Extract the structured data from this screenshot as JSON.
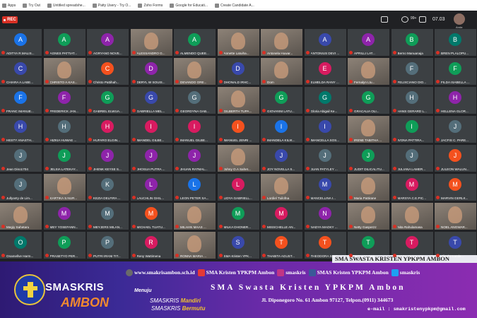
{
  "bookmarks": [
    "Apps",
    "Try Out",
    "Untitled spreadshe...",
    "Patty Usery - Try O...",
    "Zoho Forms",
    "Google for Educati...",
    "Create Candidate A..."
  ],
  "rec_label": "REC",
  "time": "07.03",
  "participant_count": "99+",
  "you_label": "Anda",
  "tiles": [
    {
      "n": "ADITYA R.MALIS...",
      "a": "A",
      "c": "#1a73e8"
    },
    {
      "n": "AGNES PATTIAT...",
      "a": "A",
      "c": "#0f9d58"
    },
    {
      "n": "AGRYANO NOVE...",
      "a": "A",
      "c": "#8e24aa"
    },
    {
      "n": "ALESSANDRO G...",
      "p": 1
    },
    {
      "n": "ALMENDO QUEE...",
      "a": "A",
      "c": "#0f9d58"
    },
    {
      "n": "Annette Latuiha...",
      "p": 1
    },
    {
      "n": "Antonela Huwar...",
      "p": 1
    },
    {
      "n": "ANTONIUS DEVI ...",
      "a": "A",
      "c": "#3949ab"
    },
    {
      "n": "APRILLI LAT...",
      "a": "A",
      "c": "#8e24aa"
    },
    {
      "n": "Berno Manuanaja",
      "a": "B",
      "c": "#0f9d58"
    },
    {
      "n": "BREN PLALOPU...",
      "a": "B",
      "c": "#00796b"
    },
    {
      "n": "CHIARA A.LABE...",
      "a": "C",
      "c": "#3949ab"
    },
    {
      "n": "CHRISTO A.KAS...",
      "p": 1
    },
    {
      "n": "Christo Pattihah...",
      "a": "C",
      "c": "#f4511e"
    },
    {
      "n": "DERYL W SOUIS...",
      "a": "D",
      "c": "#8e24aa"
    },
    {
      "n": "DEVANDO ORE...",
      "p": 1
    },
    {
      "n": "DHONALD IRHC...",
      "a": "D",
      "c": "#3949ab"
    },
    {
      "n": "Dom",
      "p": 1
    },
    {
      "n": "ELMELDA RANY ...",
      "a": "E",
      "c": "#d81b60"
    },
    {
      "n": "Fernalyn Ltu...",
      "p": 1
    },
    {
      "n": "FELIXCIANO DIO...",
      "a": "F",
      "c": "#546e7a"
    },
    {
      "n": "FILDA ISABELLA ...",
      "a": "F",
      "c": "#0f9d58"
    },
    {
      "n": "FRANC IMANUE...",
      "a": "F",
      "c": "#1a73e8"
    },
    {
      "n": "FREDERICK JAN...",
      "a": "F",
      "c": "#8e24aa"
    },
    {
      "n": "GABRIEL ELWUA...",
      "a": "G",
      "c": "#0f9d58"
    },
    {
      "n": "GABRIELLA MEL...",
      "a": "G",
      "c": "#3949ab"
    },
    {
      "n": "GEORDYNA GAB...",
      "a": "G",
      "c": "#546e7a"
    },
    {
      "n": "GILBERTH TUPA...",
      "p": 1
    },
    {
      "n": "GIOVANNI LATU...",
      "a": "G",
      "c": "#0f9d58"
    },
    {
      "n": "Gloria Abigail Ke...",
      "a": "G",
      "c": "#00796b"
    },
    {
      "n": "GRACALIA OLI...",
      "a": "G",
      "c": "#0f9d58"
    },
    {
      "n": "HANS GERARD L...",
      "a": "H",
      "c": "#546e7a"
    },
    {
      "n": "HELLENA GLOR...",
      "a": "H",
      "c": "#8e24aa"
    },
    {
      "n": "HESTY ANASTH...",
      "a": "H",
      "c": "#3949ab"
    },
    {
      "n": "HIZKIA HUWAE ...",
      "a": "H",
      "c": "#546e7a"
    },
    {
      "n": "HUFARO ELGIN...",
      "a": "H",
      "c": "#d81b60"
    },
    {
      "n": "IMANDEL GILBE...",
      "a": "I",
      "c": "#d81b60"
    },
    {
      "n": "IMANUEL GILBE...",
      "a": "I",
      "c": "#d81b60"
    },
    {
      "n": "IMANUEL JENRI ...",
      "a": "I",
      "c": "#f4511e"
    },
    {
      "n": "IMANDELA KILIK...",
      "a": "I",
      "c": "#1a73e8"
    },
    {
      "n": "IMANCELLA SOS...",
      "a": "I",
      "c": "#3949ab"
    },
    {
      "n": "IRENE TABITHA ...",
      "p": 1
    },
    {
      "n": "IVONA PATTIRA...",
      "a": "I",
      "c": "#0f9d58"
    },
    {
      "n": "JACFIS C. PARE...",
      "a": "J",
      "c": "#546e7a"
    },
    {
      "n": "Jean Dino1704",
      "a": "J",
      "c": "#546e7a"
    },
    {
      "n": "JELSIA LATEKAY...",
      "a": "J",
      "c": "#0f9d58"
    },
    {
      "n": "JHENK KEYSE S...",
      "a": "J",
      "c": "#8e24aa"
    },
    {
      "n": "JHOSUA PUTRA ...",
      "a": "J",
      "c": "#8e24aa"
    },
    {
      "n": "JHUAN RATMAL...",
      "a": "J",
      "c": "#8e24aa"
    },
    {
      "n": "Johny O.A Sahet...",
      "p": 1
    },
    {
      "n": "JOY NOVELLA S...",
      "a": "J",
      "c": "#3949ab"
    },
    {
      "n": "JUAN PATYLEY ...",
      "a": "J",
      "c": "#546e7a"
    },
    {
      "n": "JUDIT DILICALITU...",
      "a": "J",
      "c": "#0f9d58"
    },
    {
      "n": "JULIANA LAMER...",
      "a": "J",
      "c": "#546e7a"
    },
    {
      "n": "JULEON WALUN...",
      "a": "J",
      "c": "#f4511e"
    },
    {
      "n": "Jullyanty de Lim...",
      "a": "J",
      "c": "#546e7a"
    },
    {
      "n": "KARTIKA S.NUR...",
      "p": 1
    },
    {
      "n": "KEZIA DELFIRA ...",
      "a": "K",
      "c": "#546e7a"
    },
    {
      "n": "LAUCHLIN GHIL...",
      "a": "L",
      "c": "#8e24aa"
    },
    {
      "n": "LEON PETER SA...",
      "a": "L",
      "c": "#1a73e8"
    },
    {
      "n": "LIDYA GABRIELL...",
      "a": "L",
      "c": "#d81b60"
    },
    {
      "n": "Lordiel Tuilofna",
      "p": 1
    },
    {
      "n": "MANCELLINA I...",
      "a": "M",
      "c": "#3949ab"
    },
    {
      "n": "Maria Pattirane",
      "p": 1
    },
    {
      "n": "MARSYA C.E.PIC...",
      "a": "M",
      "c": "#d81b60"
    },
    {
      "n": "MARVIN GERLK...",
      "a": "M",
      "c": "#f4511e"
    },
    {
      "n": "Megiy Sahetaru",
      "p": 1
    },
    {
      "n": "MEY YOSEFANN...",
      "a": "M",
      "c": "#8e24aa"
    },
    {
      "n": "MEYJERS MILAN...",
      "a": "M",
      "c": "#546e7a"
    },
    {
      "n": "MICHAEL TUATU...",
      "a": "M",
      "c": "#f4511e"
    },
    {
      "n": "MILHAN MAAS ...",
      "p": 1
    },
    {
      "n": "MILKA DHONER...",
      "a": "M",
      "c": "#0f9d58"
    },
    {
      "n": "MISSCHELLE AN...",
      "a": "M",
      "c": "#d81b60"
    },
    {
      "n": "NADYA MAOKY ...",
      "a": "N",
      "c": "#8e24aa"
    },
    {
      "n": "Netty Gasperzz",
      "p": 1
    },
    {
      "n": "Nita Rahulamasa",
      "p": 1
    },
    {
      "n": "NOEL ANGWAR...",
      "p": 1
    },
    {
      "n": "Onamellve Harm...",
      "a": "O",
      "c": "#00796b"
    },
    {
      "n": "PRASETYO PER...",
      "a": "P",
      "c": "#0f9d58"
    },
    {
      "n": "PUTRI IRANI TIT...",
      "a": "P",
      "c": "#546e7a"
    },
    {
      "n": "Reny Wattimena",
      "a": "R",
      "c": "#d81b60"
    },
    {
      "n": "RONNA MARIA ...",
      "p": 1
    },
    {
      "n": "SMA Kristen YPK...",
      "a": "S",
      "c": "#3949ab"
    },
    {
      "n": "THABITA AGUST...",
      "a": "T",
      "c": "#f4511e"
    },
    {
      "n": "THEODORA SOFI...",
      "a": "T",
      "c": "#f4511e"
    },
    {
      "n": "THINAYA REK...",
      "a": "T",
      "c": "#0f9d58"
    },
    {
      "n": "TIARA TESALONI...",
      "a": "T",
      "c": "#d81b60"
    },
    {
      "n": "Tiineke Luntie...",
      "a": "T",
      "c": "#3949ab"
    }
  ],
  "banner": {
    "ticker": "SMA SWASTA KRISTEN YPKPM AMBON",
    "website": "www.smakrisambon.sch.id",
    "youtube": "SMA Kristen YPKPM Ambon",
    "instagram": "smaskris",
    "facebook": "SMAS Kristen YPKPM Ambon",
    "twitter": "smaskris",
    "smaskris": "SMASKRIS",
    "ambon": "AMBON",
    "menuju": "Menuju",
    "slogan1_a": "SMASKRIS ",
    "slogan1_b": "Mandiri",
    "slogan2_a": "SMASKRIS ",
    "slogan2_b": "Bermutu",
    "title": "SMA Swasta Kristen YPKPM Ambon",
    "address": "Jl. Diponegoro  No. 61 Ambon 97127, Telpon.(0911) 344673",
    "email": "e-mail : smakristenypkpm@gmail.com",
    "colors": {
      "youtube": "#e53935",
      "instagram": "#c13584",
      "facebook": "#3b5998",
      "twitter": "#1da1f2",
      "website": "#6a6a6a"
    }
  }
}
